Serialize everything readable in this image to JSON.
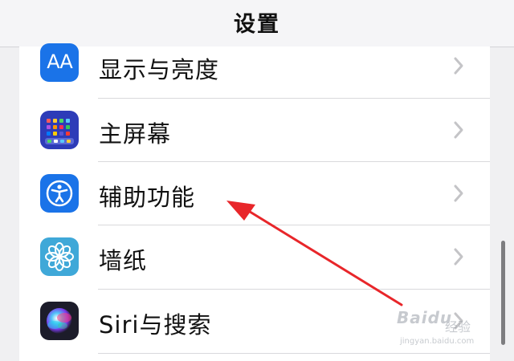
{
  "header": {
    "title": "设置"
  },
  "rows": [
    {
      "label": "显示与亮度",
      "icon": "display-brightness-icon",
      "icon_text": "AA",
      "color": "#1a73e8"
    },
    {
      "label": "主屏幕",
      "icon": "home-screen-icon",
      "color": "#2d3cb8"
    },
    {
      "label": "辅助功能",
      "icon": "accessibility-icon",
      "color": "#1a73e8"
    },
    {
      "label": "墙纸",
      "icon": "wallpaper-icon",
      "color": "#3fa8d8"
    },
    {
      "label": "Siri与搜索",
      "icon": "siri-icon",
      "color": "#1c1c2a"
    }
  ],
  "annotation": {
    "color": "#e8262a",
    "points_to": "辅助功能"
  },
  "watermark": {
    "brand": "Baidu",
    "word": "经验",
    "url": "jingyan.baidu.com"
  }
}
